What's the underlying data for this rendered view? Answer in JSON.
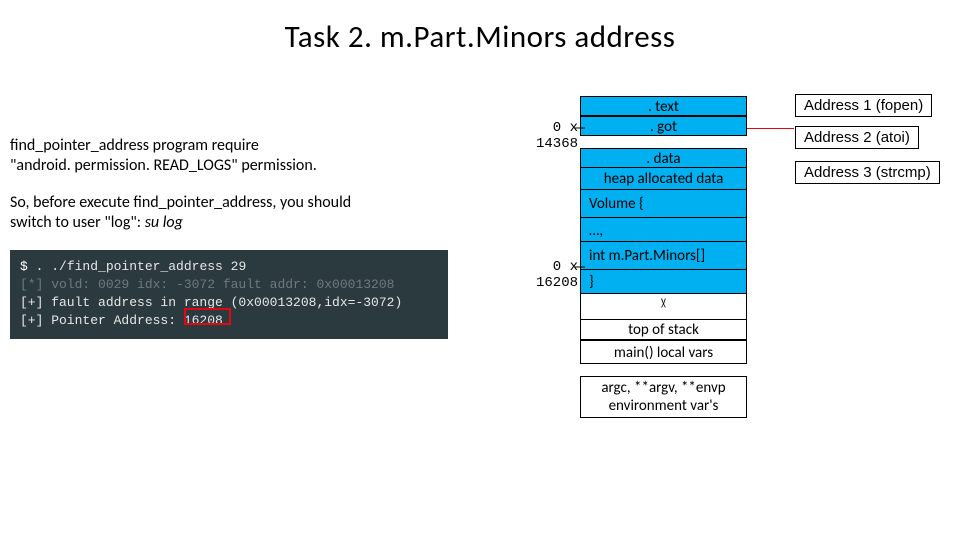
{
  "title": "Task 2. m.Part.Minors address",
  "para1_a": "find_pointer_address program require",
  "para1_b": "\"android. permission. READ_LOGS\" permission.",
  "para2_a": "So, before execute find_pointer_address, you should",
  "para2_b": "switch to user \"log\": su log",
  "terminal": {
    "l1_prompt": "$",
    "l1_cmd": " . ./find_pointer_address 29",
    "l2": "[*] vold: 0029 idx: -3072 fault addr: 0x00013208",
    "l3": "[+] fault address in range (0x00013208,idx=-3072)",
    "l4": "[+] Pointer Address: 16208"
  },
  "mem": {
    "text": ". text",
    "got": ". got",
    "data": ". data",
    "heap": "heap allocated data",
    "vol": "Volume {",
    "dots": "…,",
    "mpart": "int m.Part.Minors[]",
    "close": "}",
    "arrow_down": "v",
    "arrow_up": "^",
    "top": "top of stack",
    "main": "main() local vars",
    "argc1": "argc, **argv, **envp",
    "argc2": "environment var's"
  },
  "labels": {
    "got_addr": "0 x 14368",
    "mpart_addr": "0 x 16208"
  },
  "addr_boxes": {
    "a1": "Address 1 (fopen)",
    "a2": "Address 2 (atoi)",
    "a3": "Address 3 (strcmp)"
  }
}
